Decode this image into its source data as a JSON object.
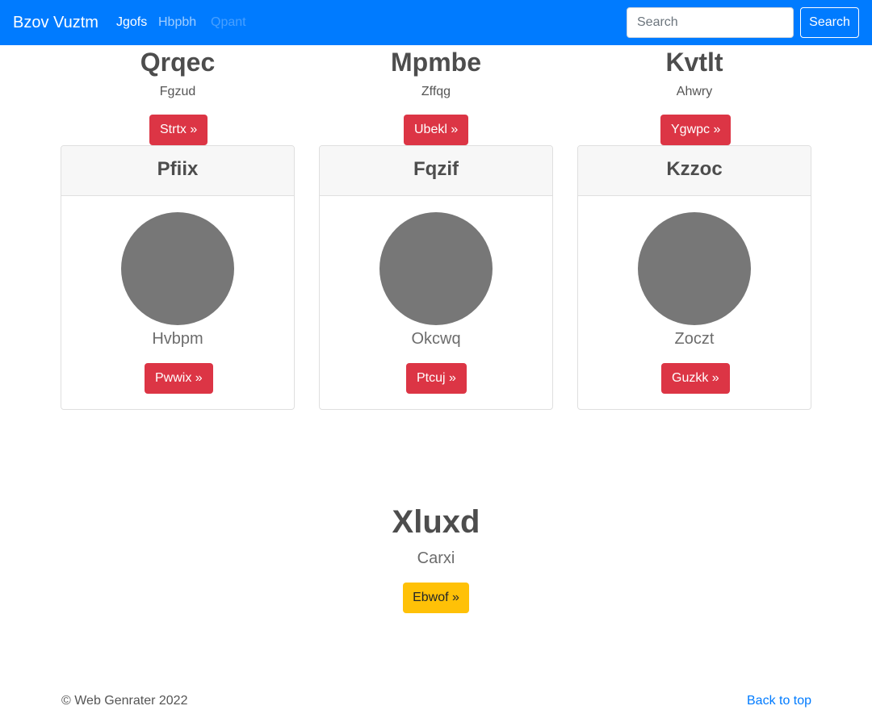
{
  "navbar": {
    "brand": "Bzov Vuztm",
    "links": [
      {
        "label": "Jgofs",
        "state": "active"
      },
      {
        "label": "Hbpbh",
        "state": "normal"
      },
      {
        "label": "Qpant",
        "state": "disabled"
      }
    ],
    "search_placeholder": "Search",
    "search_button": "Search",
    "color": "#007bff"
  },
  "columns": [
    {
      "title": "Qrqec",
      "text": "Fgzud",
      "button": "Strtx »"
    },
    {
      "title": "Mpmbe",
      "text": "Zffqg",
      "button": "Ubekl »"
    },
    {
      "title": "Kvtlt",
      "text": "Ahwry",
      "button": "Ygwpc »"
    }
  ],
  "cards": [
    {
      "header": "Pfiix",
      "label": "Hvbpm",
      "button": "Pwwix »"
    },
    {
      "header": "Fqzif",
      "label": "Okcwq",
      "button": "Ptcuj »"
    },
    {
      "header": "Kzzoc",
      "label": "Zoczt",
      "button": "Guzkk »"
    }
  ],
  "hero": {
    "title": "Xluxd",
    "subtitle": "Carxi",
    "button": "Ebwof »"
  },
  "footer": {
    "copyright": "© Web Genrater 2022",
    "back_to_top": "Back to top"
  },
  "colors": {
    "primary": "#007bff",
    "danger": "#dc3545",
    "warning": "#ffc107",
    "avatar": "#777777"
  }
}
